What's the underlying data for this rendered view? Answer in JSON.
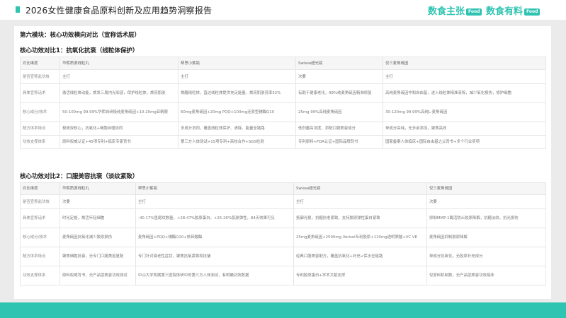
{
  "header": {
    "title": "2026女性健康食品原料创新及应用趋势洞察报告",
    "brand_primary": "数食主张",
    "brand_primary_badge": "Food",
    "brand_secondary": "数食有料",
    "brand_secondary_badge": "Food",
    "accent_color": "#2fc4b2"
  },
  "module_title": "第六模块：核心功效横向对比（宣称话术层）",
  "sections": [
    {
      "title": "核心功效对比1：抗氧化抗衰（线粒体保护）",
      "columns": [
        "对比维度",
        "华熙质源线粒丸",
        "帮思小紫瓶",
        "Swisse超光瓶",
        "仅三麦角硫因"
      ],
      "rows": [
        [
          "是否宣称此功效",
          "主打",
          "主打",
          "次要",
          "主打"
        ],
        [
          "具体宣称话术",
          "激活线粒体动能，焕发三周内光彩感，保护线粒体，焕亮肌肤",
          "焕醒线粒体，直达线粒体提供充足能量，焕亮肌肤亮率52%",
          "有助于健康老化，99%纯麦角硫因精准修复",
          "高纯麦角硫因中和自由基，进入线粒体精准清除，减少氧化损伤，修护细胞"
        ],
        [
          "核心成分/技术",
          "50-100mg 99.99%华熙自研极纯麦角硫因+10-20mg亚精胺",
          "60mg麦角硫因+20mg PQQ+100mg还原型辅酶Q10",
          "25mg 99%高纯麦角硫因",
          "30-120mg 99.99%高纯L-麦角硫因"
        ],
        [
          "配方体系特点",
          "极简双核心，抗氧化+细胞自噬协同",
          "多成分协同，覆盖线粒体保护、清除、能量全链路",
          "低剂量高浓度，添配口服美容成分",
          "单成分高纯，无多余添加，聚焦高效"
        ],
        [
          "功效支撑体系",
          "原料权威认证+45项专利+临床专家背书",
          "第三方人体测试+15项专利+高校合作+SGS检测",
          "专利原料+FDA认证+国际品牌背书",
          "国家备案人体临床+国际自由基之父背书+多个行业奖项"
        ]
      ]
    },
    {
      "title": "核心功效对比2：口服美容抗衰（淡纹紧致）",
      "columns": [
        "对比维度",
        "华熙质源线粒丸",
        "帮思小紫瓶",
        "Swisse超光瓶",
        "仅三麦角硫因"
      ],
      "rows": [
        [
          "是否宣称此功效",
          "次要",
          "主打",
          "主打",
          "次要"
        ],
        [
          "具体宣称话术",
          "时光定格，焕活年轻细胞",
          "-40.17%鱼尾纹数量，+28.47%胶原蛋白，+25.26%肌肤弹性，84天效果可见",
          "抵御光损，抗糖抗老紧致，支持胶原弹性蛋白紧致",
          "抑制MMP-1酶活防止胶原降解，抗糖淡纹，抗光损伤"
        ],
        [
          "核心成分/技术",
          "麦角硫因抗氧化减少胶原损伤",
          "麦角硫因+PQQ+辅酶Q10+核苷酸酶",
          "25mg麦角硫因+2500mg Verisol专利胶原+120mg透明质酸+VC VE",
          "麦角硫因抑制胶原降解"
        ],
        [
          "配方体系特点",
          "聚焦细胞抗衰，无专门口服美容复配",
          "专门针对衰老性症状，聚焦抗氧紧致和抗皱",
          "经典口服美容配方，覆盖抗氧化+补充+保水全链路",
          "单成分抗氧化，无胶原补充成分"
        ],
        [
          "功效支撑体系",
          "原料权威背书，无产品层美容功效测试",
          "中山大学附属第三医院体研中的第三方人体测试，有明确功效数据",
          "专利胶原蛋白+学术文献支撑",
          "仅原料机制数，无产品层美容功效临床"
        ]
      ]
    }
  ]
}
